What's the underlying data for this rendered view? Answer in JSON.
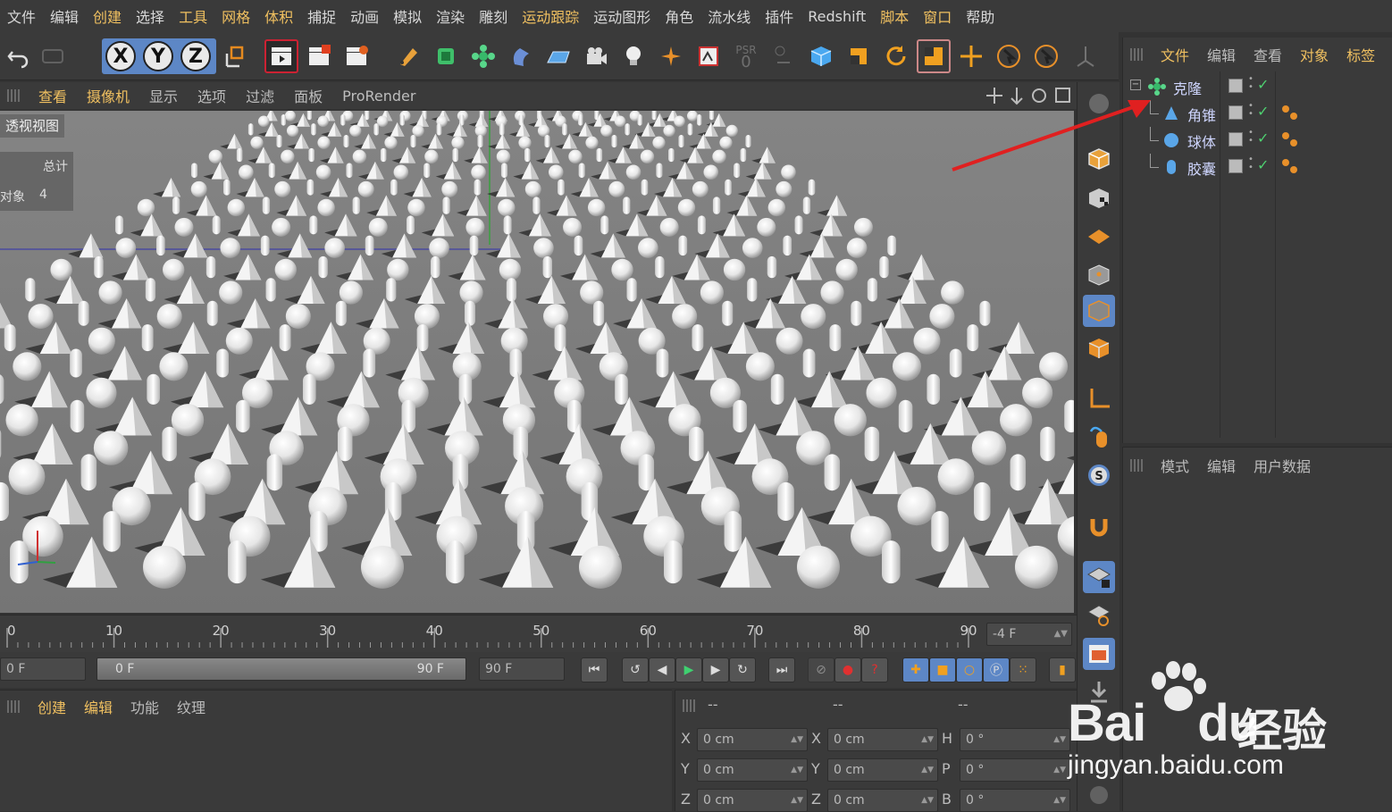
{
  "menubar": {
    "items": [
      {
        "label": "文件",
        "hl": false
      },
      {
        "label": "编辑",
        "hl": false
      },
      {
        "label": "创建",
        "hl": true
      },
      {
        "label": "选择",
        "hl": false
      },
      {
        "label": "工具",
        "hl": true
      },
      {
        "label": "网格",
        "hl": true
      },
      {
        "label": "体积",
        "hl": true
      },
      {
        "label": "捕捉",
        "hl": false
      },
      {
        "label": "动画",
        "hl": false
      },
      {
        "label": "模拟",
        "hl": false
      },
      {
        "label": "渲染",
        "hl": false
      },
      {
        "label": "雕刻",
        "hl": false
      },
      {
        "label": "运动跟踪",
        "hl": true
      },
      {
        "label": "运动图形",
        "hl": false
      },
      {
        "label": "角色",
        "hl": false
      },
      {
        "label": "流水线",
        "hl": false
      },
      {
        "label": "插件",
        "hl": false
      },
      {
        "label": "Redshift",
        "hl": false
      },
      {
        "label": "脚本",
        "hl": true
      },
      {
        "label": "窗口",
        "hl": true
      },
      {
        "label": "帮助",
        "hl": false
      }
    ]
  },
  "toolbar": {
    "x_label": "X",
    "y_label": "Y",
    "z_label": "Z",
    "psr_label": "PSR",
    "psr_value": "0"
  },
  "viewport_menu": {
    "items": [
      {
        "label": "查看",
        "hl": true
      },
      {
        "label": "摄像机",
        "hl": true
      },
      {
        "label": "显示",
        "hl": false
      },
      {
        "label": "选项",
        "hl": false
      },
      {
        "label": "过滤",
        "hl": false
      },
      {
        "label": "面板",
        "hl": false
      },
      {
        "label": "ProRender",
        "hl": false
      }
    ]
  },
  "viewport": {
    "label": "透视视图",
    "stats_header": "总计",
    "stats_label": "对象",
    "stats_value": "4"
  },
  "object_manager": {
    "menu": [
      {
        "label": "文件",
        "hl": true
      },
      {
        "label": "编辑",
        "hl": false
      },
      {
        "label": "查看",
        "hl": false
      },
      {
        "label": "对象",
        "hl": true
      },
      {
        "label": "标签",
        "hl": true
      }
    ],
    "objects": [
      {
        "name": "克隆",
        "icon": "cloner-icon",
        "level": 0
      },
      {
        "name": "角锥",
        "icon": "cone-icon",
        "level": 1
      },
      {
        "name": "球体",
        "icon": "sphere-icon",
        "level": 1
      },
      {
        "name": "胶囊",
        "icon": "capsule-icon",
        "level": 1
      }
    ]
  },
  "attribute_manager": {
    "menu": [
      "模式",
      "编辑",
      "用户数据"
    ]
  },
  "timeline": {
    "ticks": [
      "0",
      "10",
      "20",
      "30",
      "40",
      "50",
      "60",
      "70",
      "80",
      "90"
    ],
    "current_frame": "-4 F"
  },
  "transport": {
    "start_field": "0 F",
    "range_start": "0 F",
    "range_end": "90 F",
    "end_field": "90 F"
  },
  "material_manager": {
    "menu": [
      {
        "label": "创建",
        "hl": true
      },
      {
        "label": "编辑",
        "hl": true
      },
      {
        "label": "功能",
        "hl": false
      },
      {
        "label": "纹理",
        "hl": false
      }
    ]
  },
  "coordinates": {
    "headers": [
      "--",
      "--",
      "--"
    ],
    "rows": [
      {
        "a": "X",
        "av": "0 cm",
        "b": "X",
        "bv": "0 cm",
        "c": "H",
        "cv": "0 °"
      },
      {
        "a": "Y",
        "av": "0 cm",
        "b": "Y",
        "bv": "0 cm",
        "c": "P",
        "cv": "0 °"
      },
      {
        "a": "Z",
        "av": "0 cm",
        "b": "Z",
        "bv": "0 cm",
        "c": "B",
        "cv": "0 °"
      }
    ]
  },
  "watermark": {
    "brand": "Bai",
    "brand2": "du",
    "cn": "经验",
    "url": "jingyan.baidu.com"
  },
  "colors": {
    "accent_blue": "#5d87c6",
    "highlight_menu": "#f0c060",
    "arrow": "#e02020"
  }
}
